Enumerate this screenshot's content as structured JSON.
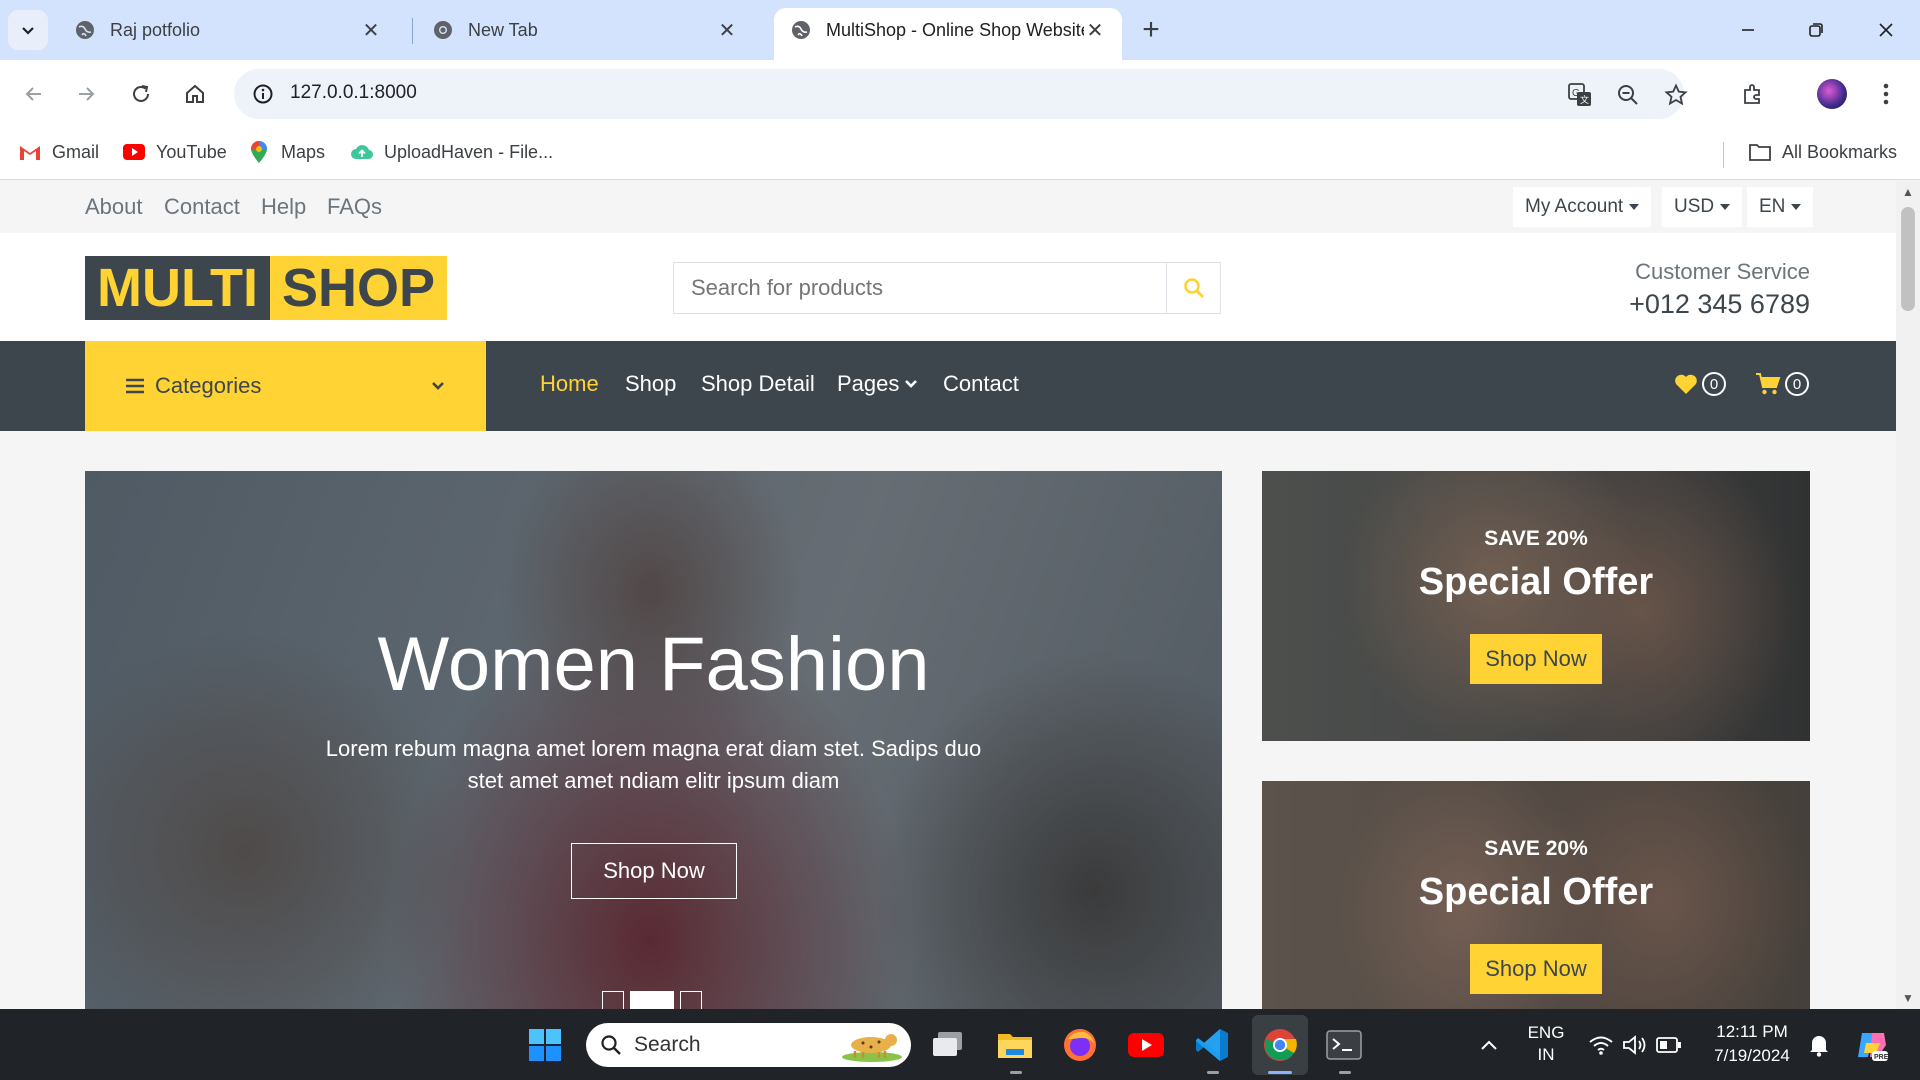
{
  "browser": {
    "tabs": [
      {
        "title": "Raj potfolio",
        "active": false
      },
      {
        "title": "New Tab",
        "active": false
      },
      {
        "title": "MultiShop - Online Shop Website Template",
        "active": true
      }
    ],
    "url": "127.0.0.1:8000",
    "bookmarks": [
      {
        "label": "Gmail"
      },
      {
        "label": "YouTube"
      },
      {
        "label": "Maps"
      },
      {
        "label": "UploadHaven - File..."
      }
    ],
    "all_bookmarks_label": "All Bookmarks"
  },
  "site": {
    "topbar": {
      "links": [
        "About",
        "Contact",
        "Help",
        "FAQs"
      ],
      "account_label": "My Account",
      "currency_label": "USD",
      "language_label": "EN"
    },
    "logo": {
      "part1": "MULTI",
      "part2": "SHOP"
    },
    "search": {
      "placeholder": "Search for products"
    },
    "customer_service": {
      "label": "Customer Service",
      "phone": "+012 345 6789"
    },
    "navbar": {
      "categories_label": "Categories",
      "links": [
        "Home",
        "Shop",
        "Shop Detail",
        "Pages",
        "Contact"
      ],
      "active_link": "Home",
      "wishlist_count": "0",
      "cart_count": "0"
    },
    "hero": {
      "title": "Women Fashion",
      "text": "Lorem rebum magna amet lorem magna erat diam stet. Sadips duo stet amet amet ndiam elitr ipsum diam",
      "button_label": "Shop Now",
      "slide_count": 3,
      "active_slide": 2
    },
    "offers": [
      {
        "save": "SAVE 20%",
        "title": "Special Offer",
        "button_label": "Shop Now"
      },
      {
        "save": "SAVE 20%",
        "title": "Special Offer",
        "button_label": "Shop Now"
      }
    ],
    "colors": {
      "primary": "#FFD333",
      "dark": "#3D464D",
      "light": "#F5F5F5"
    }
  },
  "taskbar": {
    "search_label": "Search",
    "language": {
      "line1": "ENG",
      "line2": "IN"
    },
    "time": "12:11 PM",
    "date": "7/19/2024",
    "pinned_icons": [
      "windows-start-icon",
      "task-view-icon",
      "file-explorer-icon",
      "firefox-icon",
      "youtube-icon",
      "vscode-icon",
      "chrome-icon",
      "terminal-icon"
    ]
  }
}
